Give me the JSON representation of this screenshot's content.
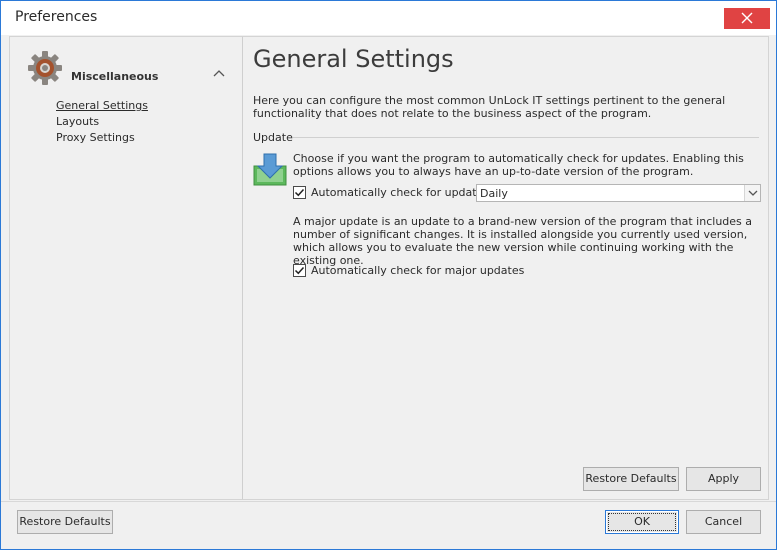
{
  "window": {
    "title": "Preferences"
  },
  "sidebar": {
    "group_title": "Miscellaneous",
    "items": [
      {
        "label": "General Settings",
        "active": true
      },
      {
        "label": "Layouts",
        "active": false
      },
      {
        "label": "Proxy Settings",
        "active": false
      }
    ]
  },
  "main": {
    "title": "General Settings",
    "intro": "Here you can configure the most common UnLock IT settings pertinent to the general functionality that does not relate to the business aspect of the program.",
    "section_label": "Update",
    "update_desc": "Choose if you want the program to automatically check for updates. Enabling this options allows you to always have an up-to-date version of the program.",
    "auto_check_label": "Automatically check for updates:",
    "auto_check_checked": true,
    "frequency_value": "Daily",
    "major_desc": "A major update is an update to a brand-new version of the program that includes a number of significant changes. It is installed alongside you currently used version, which allows you to evaluate the new version while continuing working with the existing one.",
    "major_check_label": "Automatically check for major updates",
    "major_check_checked": true,
    "restore_defaults_label": "Restore Defaults",
    "apply_label": "Apply"
  },
  "footer": {
    "restore_defaults_label": "Restore Defaults",
    "ok_label": "OK",
    "cancel_label": "Cancel"
  },
  "colors": {
    "accent": "#2b79d7",
    "close_button": "#e04343",
    "update_icon_green": "#5cb85c",
    "update_icon_arrow": "#5a9bd5"
  },
  "icons": {
    "close": "close-icon",
    "group": "gear-icon",
    "collapse": "chevron-up-icon",
    "update": "download-arrow-icon",
    "dropdown": "chevron-down-icon",
    "check": "check-icon"
  }
}
